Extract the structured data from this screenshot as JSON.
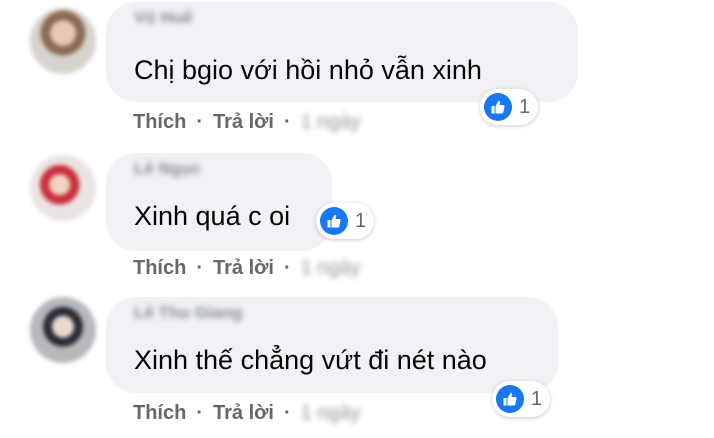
{
  "comments": [
    {
      "author": "Vũ Huế",
      "text": "Chị bgio với hồi nhỏ vẫn xinh",
      "reaction_count": "1",
      "like_label": "Thích",
      "reply_label": "Trả lời",
      "separator": "·",
      "timestamp": "1 ngày"
    },
    {
      "author": "Lê Ngọc",
      "text": "Xinh quá c oi",
      "reaction_count": "1",
      "like_label": "Thích",
      "reply_label": "Trả lời",
      "separator": "·",
      "timestamp": "1 ngày"
    },
    {
      "author": "Lê Thu Giang",
      "text": "Xinh thế chẳng vứt đi nét nào",
      "reaction_count": "1",
      "like_label": "Thích",
      "reply_label": "Trả lời",
      "separator": "·",
      "timestamp": "1 ngày"
    }
  ],
  "reaction_icon": "thumbs-up-icon",
  "colors": {
    "bubble": "#f0f2f5",
    "like_blue": "#1877f2",
    "meta_text": "#65676b",
    "body_text": "#050505"
  }
}
